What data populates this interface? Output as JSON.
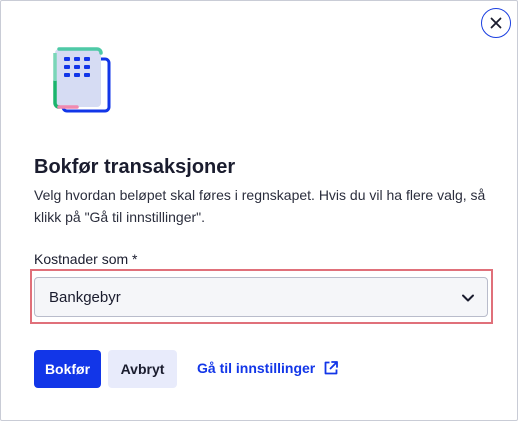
{
  "dialog": {
    "close_icon": "close-icon",
    "illustration_icon": "document-stack-icon",
    "title": "Bokfør transaksjoner",
    "description": "Velg hvordan beløpet skal føres i regnskapet. Hvis du vil ha flere valg, så klikk på \"Gå til innstillinger\".",
    "field": {
      "label": "Kostnader som *",
      "selected_value": "Bankgebyr",
      "chevron_icon": "chevron-down-icon"
    },
    "buttons": {
      "primary_label": "Bokfør",
      "secondary_label": "Avbryt",
      "link_label": "Gå til innstillinger",
      "link_icon": "external-link-icon"
    }
  },
  "colors": {
    "primary": "#1236e8",
    "secondary_bg": "#e8ebfb",
    "highlight": "#e0707a",
    "text": "#1a1c2e"
  }
}
